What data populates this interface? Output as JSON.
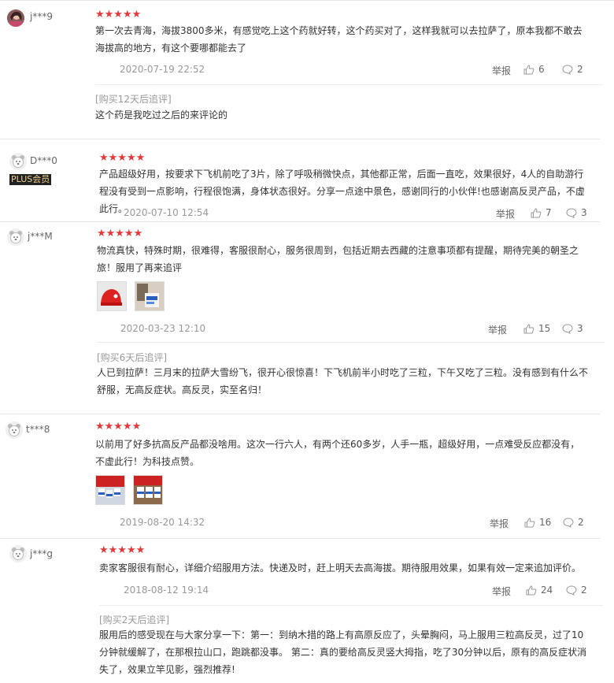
{
  "icons": {
    "stars": "five-stars",
    "report": "report-link",
    "like": "thumb-up-icon",
    "comment": "comment-bubble-icon"
  },
  "colors": {
    "star": "#e4393c",
    "plus_bg": "#222222",
    "plus_fg": "#f0d18a"
  },
  "reviews": [
    {
      "user": "j***9",
      "stars": "★★★★★",
      "content": "第一次去青海，海拔3800多米，有感觉吃上这个药就好转，这个药买对了，这样我就可以去拉萨了，原本我都不敢去海拔高的地方，有这个要哪都能去了",
      "date": "2020-07-19 22:52",
      "report": "举报",
      "likes": "6",
      "comments": "2",
      "followup_label": "[购买12天后追评]",
      "followup_text": "这个药是我吃过之后的来评论的"
    },
    {
      "user": "D***0",
      "badge": "PLUS会员",
      "stars": "★★★★★",
      "content": "产品超级好用，按要求下飞机前吃了3片，除了呼吸稍微快点，其他都正常，后面一直吃，效果很好，4人的自助游行程没有受到一点影响，行程很饱满，身体状态很好。分享一点途中景色，感谢同行的小伙伴!也感谢高反灵产品，不虚此行。",
      "date": "2020-07-10 12:54",
      "report": "举报",
      "likes": "7",
      "comments": "3"
    },
    {
      "user": "j***M",
      "stars": "★★★★★",
      "content": "物流真快，特殊时期，很难得，客服很耐心，服务很周到，包括近期去西藏的注意事项都有提醒，期待完美的朝圣之旅！服用了再来追评",
      "date": "2020-03-23 12:10",
      "report": "举报",
      "likes": "15",
      "comments": "3",
      "followup_label": "[购买6天后追评]",
      "followup_text": "人已到拉萨！三月末的拉萨大雪纷飞，很开心很惊喜！下飞机前半小时吃了三粒，下午又吃了三粒。没有感到有什么不舒服，无高反症状。高反灵，实至名归！"
    },
    {
      "user": "t***8",
      "stars": "★★★★★",
      "content": "以前用了好多抗高反产品都没啥用。这次一行六人，有两个还60多岁，人手一瓶，超级好用，一点难受反应都没有，不虚此行！为科技点赞。",
      "date": "2019-08-20 14:32",
      "report": "举报",
      "likes": "16",
      "comments": "2"
    },
    {
      "user": "j***g",
      "stars": "★★★★★",
      "content": "卖家客服很有耐心，详细介绍服用方法。快递及时，赶上明天去高海拔。期待服用效果，如果有效一定来追加评价。",
      "date": "2018-08-12 19:14",
      "report": "举报",
      "likes": "24",
      "comments": "2",
      "followup_label": "[购买2天后追评]",
      "followup_text": "服用后的感受现在与大家分享一下：第一：到纳木措的路上有高原反应了，头晕胸闷，马上服用三粒高反灵，过了10分钟就缓解了，在那根拉山口，跑跳都没事。 第二：真的要给高反灵竖大拇指，吃了30分钟以后，原有的高反症状消失了，效果立竿见影，强烈推荐!"
    }
  ]
}
